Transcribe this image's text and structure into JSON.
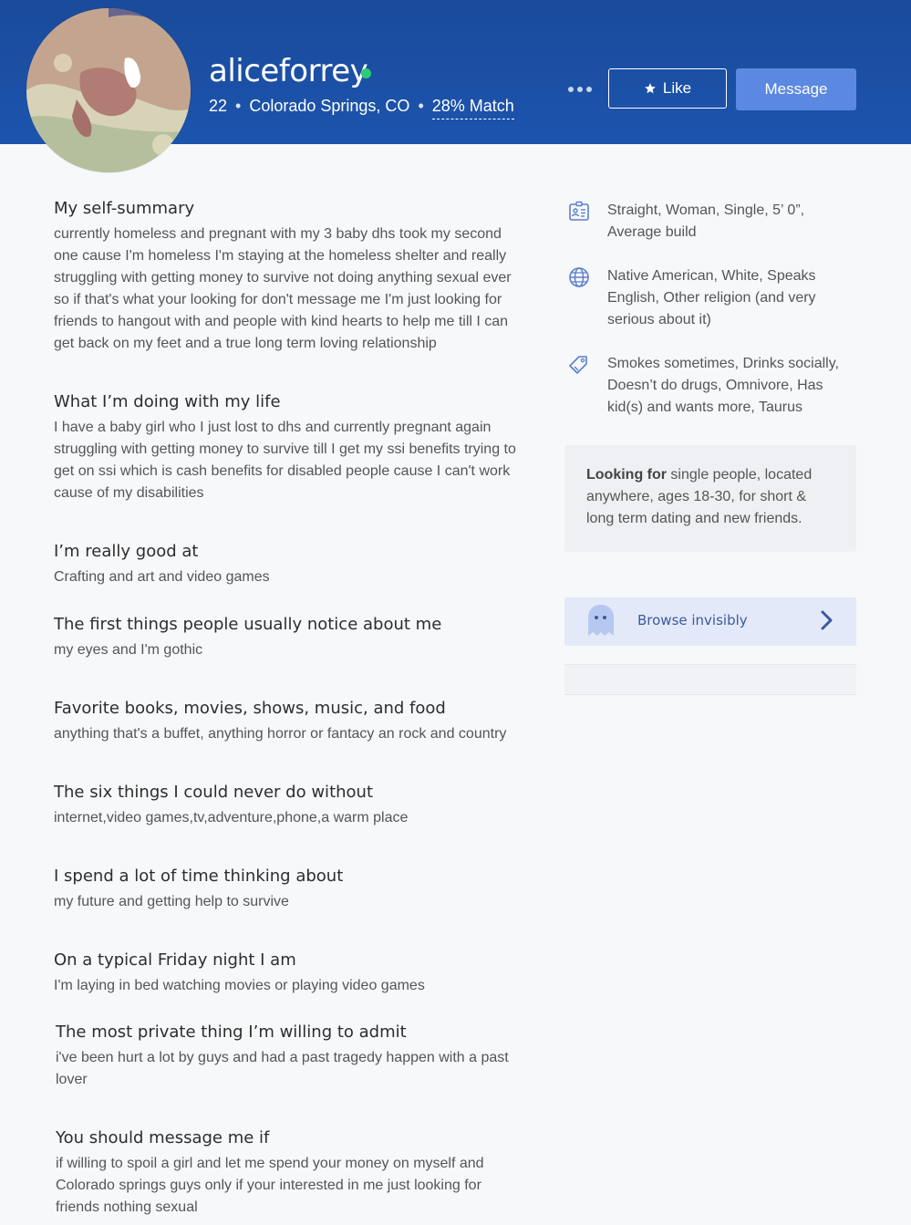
{
  "header": {
    "username": "aliceforrey",
    "age": "22",
    "location": "Colorado Springs, CO",
    "match": "28% Match",
    "separator": "•",
    "like_label": "Like",
    "message_label": "Message",
    "colors": {
      "banner": "#1a4b9b",
      "message_button": "#5b88e0",
      "online": "#2ecc71"
    }
  },
  "sections": [
    {
      "title": "My self-summary",
      "body": "currently homeless and pregnant with my 3 baby dhs took my second one cause I'm homeless I'm staying at the homeless shelter and really struggling with getting money to survive not doing anything sexual ever so if that's what your looking for don't message me I'm just looking for friends to hangout with and people with kind hearts to help me till I can get back on my feet and a true long term loving relationship"
    },
    {
      "title": "What I’m doing with my life",
      "body": "I have a baby girl who I just lost to dhs and currently pregnant again struggling with getting money to survive till I get my ssi benefits trying to get on ssi which is cash benefits for disabled people cause I can't work cause of my disabilities"
    },
    {
      "title": "I’m really good at",
      "body": "Crafting and art and video games"
    },
    {
      "title": "The first things people usually notice about me",
      "body": "my eyes and I'm gothic"
    },
    {
      "title": "Favorite books, movies, shows, music, and food",
      "body": "anything that's a buffet, anything horror or fantacy an rock and country"
    },
    {
      "title": "The six things I could never do without",
      "body": "internet,video games,tv,adventure,phone,a warm place"
    },
    {
      "title": "I spend a lot of time thinking about",
      "body": "my future and getting help to survive"
    },
    {
      "title": "On a typical Friday night I am",
      "body": "I'm laying in bed watching movies or playing video games"
    },
    {
      "title": "The most private thing I’m willing to admit",
      "body": "i've been hurt a lot by guys and had a past tragedy happen with a past lover"
    },
    {
      "title": "You should message me if",
      "body": "if willing to spoil a girl and let me spend your money on myself and Colorado springs guys only if your interested in me just looking for friends nothing sexual"
    }
  ],
  "details": [
    {
      "icon": "id-card-icon",
      "text": "Straight, Woman, Single, 5’ 0”, Average build"
    },
    {
      "icon": "globe-icon",
      "text": "Native American, White, Speaks English, Other religion (and very serious about it)"
    },
    {
      "icon": "tag-icon",
      "text": "Smokes sometimes, Drinks socially, Doesn’t do drugs, Omnivore, Has kid(s) and wants more, Taurus"
    }
  ],
  "looking_for": {
    "label": "Looking for",
    "text": " single people, located anywhere, ages 18-30, for short & long term dating and new friends."
  },
  "browse": {
    "label": "Browse invisibly",
    "icon": "ghost-icon"
  }
}
